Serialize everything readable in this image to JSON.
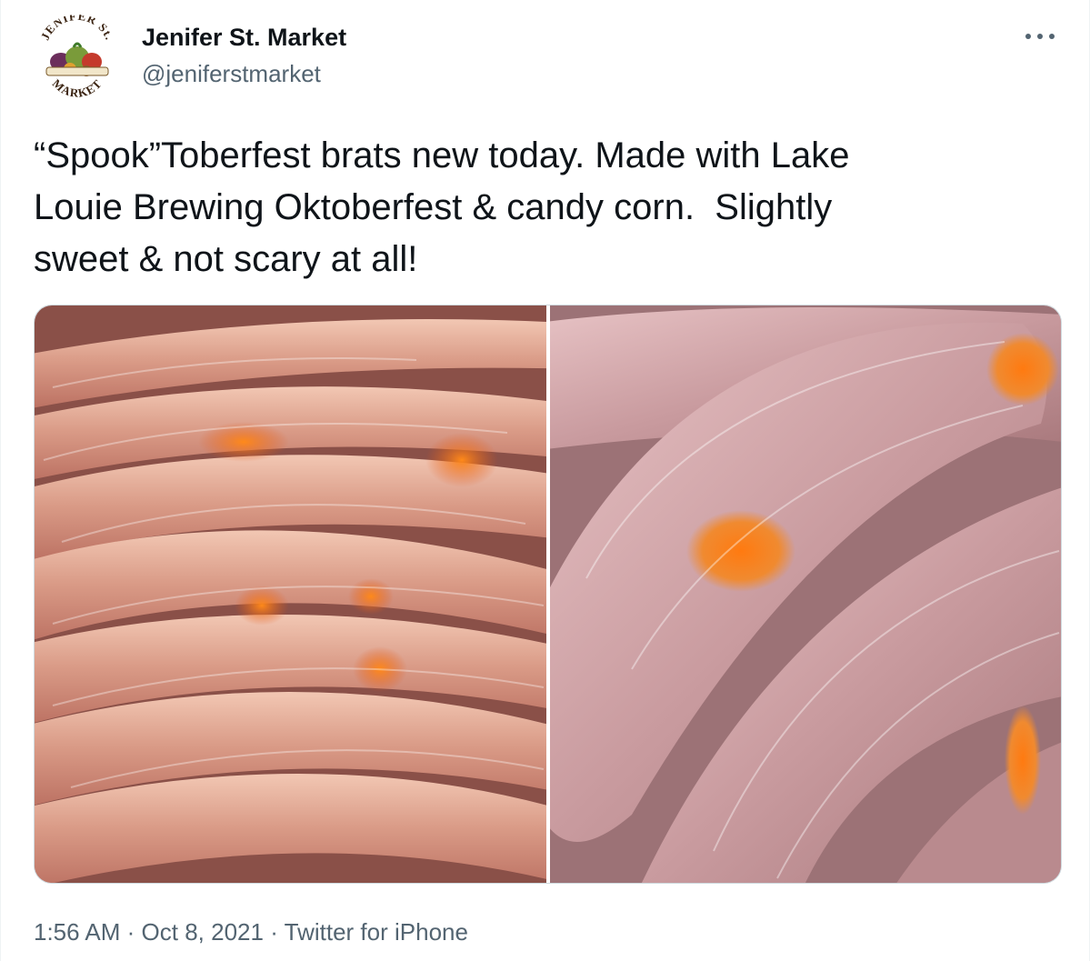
{
  "author": {
    "display_name": "Jenifer St. Market",
    "handle": "@jeniferstmarket",
    "avatar_logo_text_top": "JENIFER St.",
    "avatar_logo_text_bottom": "MARKET"
  },
  "tweet": {
    "text": "“Spook”Toberfest brats new today. Made with Lake\nLouie Brewing Oktoberfest & candy corn.  Slightly\nsweet & not scary at all!"
  },
  "media": {
    "photos": [
      {
        "subject": "raw bratwurst links with candy corn"
      },
      {
        "subject": "close-up of raw bratwurst with candy corn"
      }
    ]
  },
  "meta": {
    "time": "1:56 AM",
    "separator": "·",
    "date": "Oct 8, 2021",
    "source": "Twitter for iPhone"
  },
  "colors": {
    "text_primary": "#0f1419",
    "text_secondary": "#536471",
    "border": "#cfd9de"
  },
  "icons": {
    "more": "more-dots-icon"
  }
}
